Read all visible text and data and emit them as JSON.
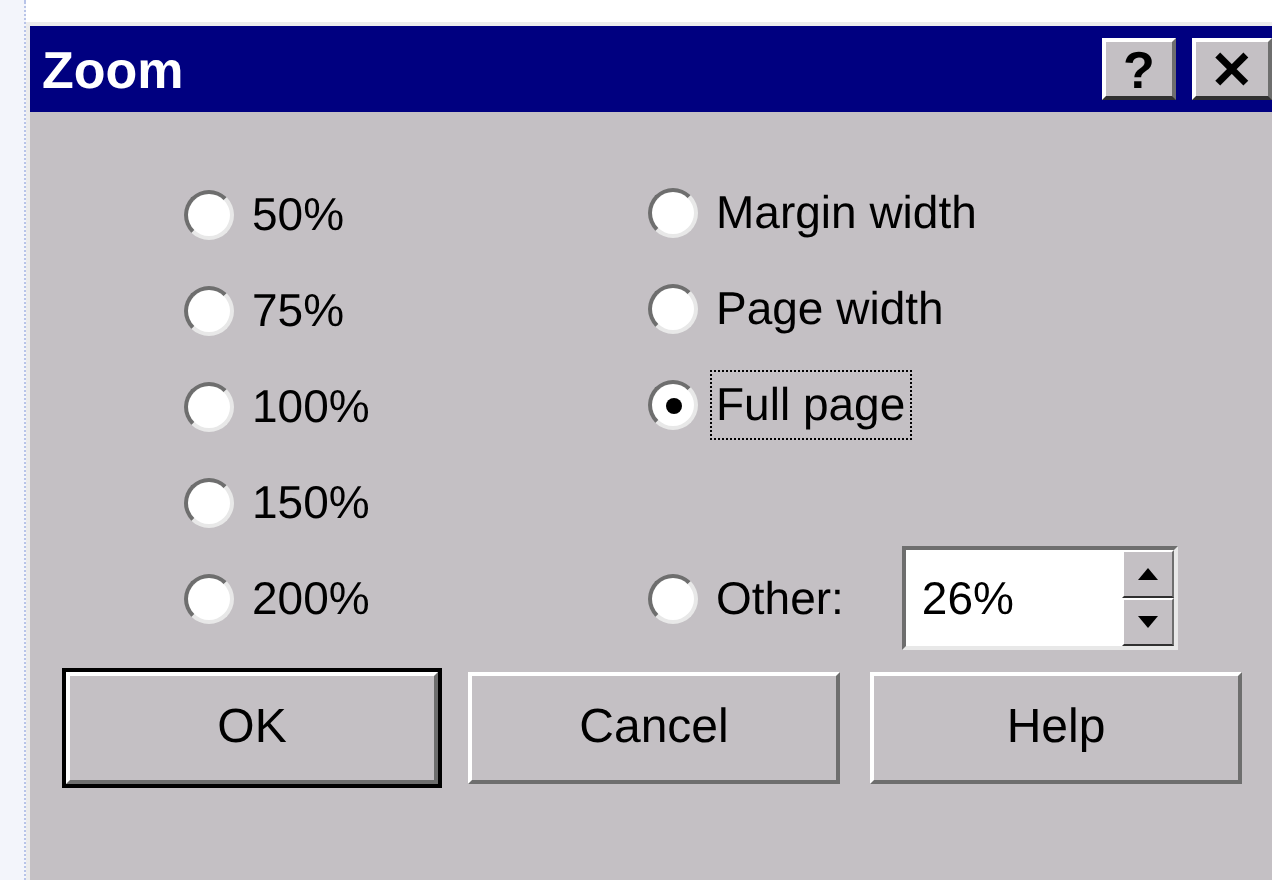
{
  "window": {
    "title": "Zoom",
    "title_buttons": [
      {
        "kind": "help",
        "label": "?"
      },
      {
        "kind": "close",
        "label": "✕"
      }
    ]
  },
  "zoom_options": [
    {
      "label": "50%",
      "selected": false
    },
    {
      "label": "75%",
      "selected": false
    },
    {
      "label": "100%",
      "selected": false
    },
    {
      "label": "150%",
      "selected": false
    },
    {
      "label": "200%",
      "selected": false
    },
    {
      "label": "Margin width",
      "selected": false
    },
    {
      "label": "Page width",
      "selected": false
    },
    {
      "label": "Full page",
      "selected": true,
      "focused": true
    },
    {
      "label": "Other:",
      "selected": false,
      "kind": "other"
    }
  ],
  "other_value": "26%",
  "buttons": [
    {
      "label": "OK",
      "default": true
    },
    {
      "label": "Cancel",
      "default": false
    },
    {
      "label": "Help",
      "default": false
    }
  ]
}
